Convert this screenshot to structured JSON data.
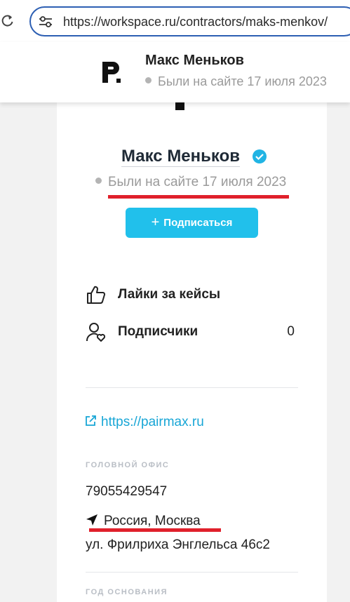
{
  "browser": {
    "url": "https://workspace.ru/contractors/maks-menkov/",
    "reload_icon": "reload-icon",
    "site_settings_icon": "tune-icon"
  },
  "sticky_header": {
    "name": "Макс Меньков",
    "status": "Были на сайте 17 июля 2023"
  },
  "profile": {
    "name": "Макс Меньков",
    "verified": true,
    "status": "Были на сайте 17 июля 2023",
    "subscribe_label": "Подписаться"
  },
  "stats": [
    {
      "label": "Лайки за кейсы",
      "value": "",
      "icon": "thumbs-up-icon"
    },
    {
      "label": "Подписчики",
      "value": "0",
      "icon": "user-heart-icon"
    }
  ],
  "contacts": {
    "website": "https://pairmax.ru",
    "head_office_label": "ГОЛОВНОЙ ОФИС",
    "phone": "79055429547",
    "location": "Россия, Москва",
    "address": "ул. Фрилриха Энглельса 46с2",
    "founded_label": "ГОД ОСНОВАНИЯ"
  },
  "colors": {
    "accent": "#21c0eb",
    "link": "#18a6d6",
    "highlight_underline": "#e0202b",
    "address_bar_border": "#2d5fb3"
  }
}
